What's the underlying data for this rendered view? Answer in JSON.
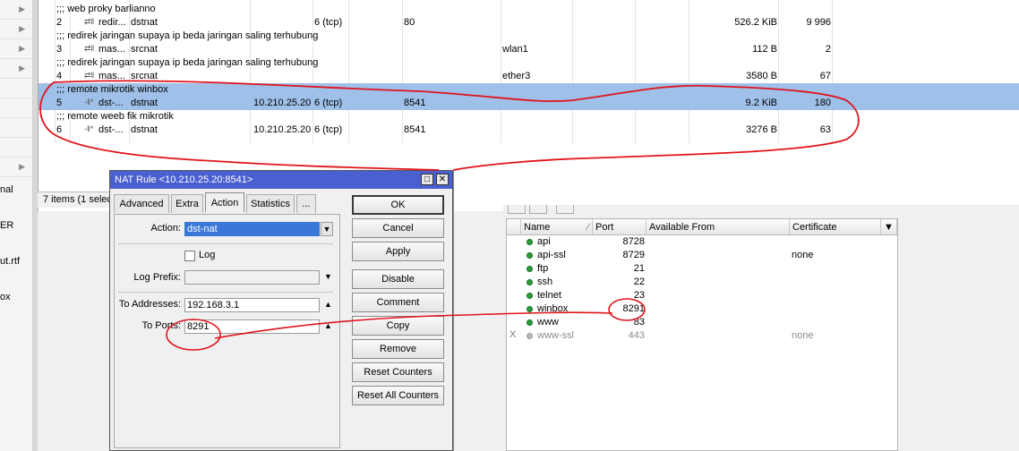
{
  "left_strip": {
    "labels": [
      "nal",
      "ER",
      "ut.rtf",
      "ox"
    ]
  },
  "nat": {
    "comments": [
      ";;; web proky barlianno",
      ";;; redirek jaringan supaya ip beda jaringan saling terhubung",
      ";;; redirek jaringan supaya ip beda jaringan saling terhubung",
      ";;; remote mikrotik winbox",
      ";;; remote weeb fik mikrotik"
    ],
    "rows": [
      {
        "num": "2",
        "icon": "⇄‖",
        "action": "redir...",
        "chain": "dstnat",
        "dst": "",
        "proto": "6 (tcp)",
        "dport": "80",
        "oif": "",
        "bytes": "526.2 KiB",
        "packets": "9 996"
      },
      {
        "num": "3",
        "icon": "⇄‖",
        "action": "mas...",
        "chain": "srcnat",
        "dst": "",
        "proto": "",
        "dport": "",
        "oif": "wlan1",
        "bytes": "112 B",
        "packets": "2"
      },
      {
        "num": "4",
        "icon": "⇄‖",
        "action": "mas...",
        "chain": "srcnat",
        "dst": "",
        "proto": "",
        "dport": "",
        "oif": "ether3",
        "bytes": "3580 B",
        "packets": "67"
      },
      {
        "num": "5",
        "icon": "-‖*",
        "action": "dst-...",
        "chain": "dstnat",
        "dst": "10.210.25.20",
        "proto": "6 (tcp)",
        "dport": "8541",
        "oif": "",
        "bytes": "9.2 KiB",
        "packets": "180"
      },
      {
        "num": "6",
        "icon": "-‖*",
        "action": "dst-...",
        "chain": "dstnat",
        "dst": "10.210.25.20",
        "proto": "6 (tcp)",
        "dport": "8541",
        "oif": "",
        "bytes": "3276 B",
        "packets": "63"
      }
    ],
    "status": "7 items (1 selec"
  },
  "dialog": {
    "title": "NAT Rule <10.210.25.20:8541>",
    "tabs": [
      "Advanced",
      "Extra",
      "Action",
      "Statistics",
      "..."
    ],
    "action_label": "Action:",
    "action_value": "dst-nat",
    "log_label": "Log",
    "log_prefix_label": "Log Prefix:",
    "to_addresses_label": "To Addresses:",
    "to_addresses_value": "192.168.3.1",
    "to_ports_label": "To Ports:",
    "to_ports_value": "8291",
    "buttons": [
      "OK",
      "Cancel",
      "Apply",
      "Disable",
      "Comment",
      "Copy",
      "Remove",
      "Reset Counters",
      "Reset All Counters"
    ]
  },
  "services": {
    "headers": [
      "Name",
      "Port",
      "Available From",
      "Certificate"
    ],
    "rows": [
      {
        "mark": "",
        "name": "api",
        "port": "8728",
        "cert": ""
      },
      {
        "mark": "",
        "name": "api-ssl",
        "port": "8729",
        "cert": "none"
      },
      {
        "mark": "",
        "name": "ftp",
        "port": "21",
        "cert": ""
      },
      {
        "mark": "",
        "name": "ssh",
        "port": "22",
        "cert": ""
      },
      {
        "mark": "",
        "name": "telnet",
        "port": "23",
        "cert": ""
      },
      {
        "mark": "",
        "name": "winbox",
        "port": "8291",
        "cert": ""
      },
      {
        "mark": "",
        "name": "www",
        "port": "83",
        "cert": ""
      },
      {
        "mark": "X",
        "name": "www-ssl",
        "port": "443",
        "cert": "none"
      }
    ]
  },
  "colors": {
    "selection": "#9fc0e8",
    "dialog_title": "#4a5fd0",
    "annotation": "#e0141c",
    "enabled_dot": "#2a9d3a"
  }
}
